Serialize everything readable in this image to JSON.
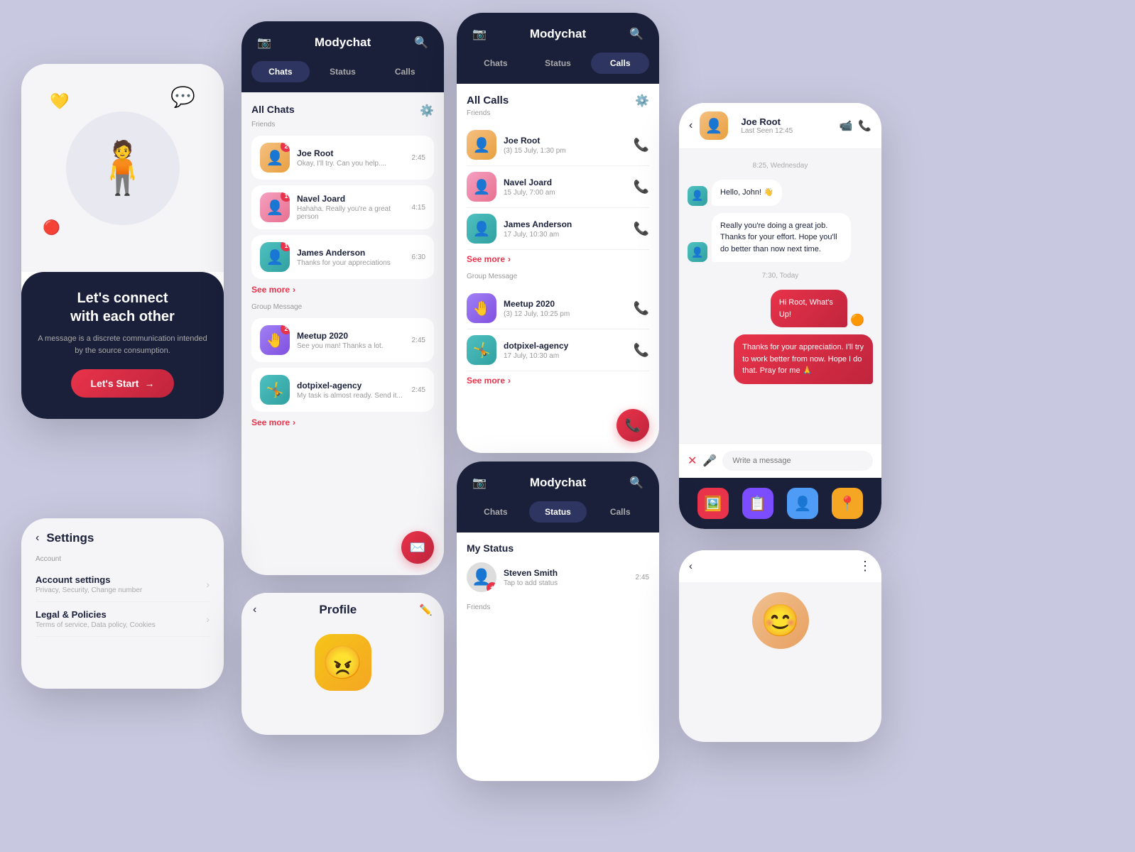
{
  "app": {
    "name": "Modychat",
    "camera_icon": "📷",
    "search_icon": "🔍"
  },
  "welcome": {
    "title": "Let's connect\nwith each other",
    "subtitle": "A message is a discrete communication intended by the source consumption.",
    "btn_label": "Let's Start",
    "btn_arrow": "→"
  },
  "tabs": {
    "chats": "Chats",
    "status": "Status",
    "calls": "Calls"
  },
  "all_chats": {
    "title": "All Chats",
    "friends_label": "Friends",
    "friends": [
      {
        "name": "Joe Root",
        "preview": "Okay, I'll try. Can you help....",
        "time": "2:45",
        "badge": "2",
        "emoji": "👤"
      },
      {
        "name": "Navel Joard",
        "preview": "Hahaha. Really you're a great person",
        "time": "4:15",
        "badge": "1",
        "emoji": "👤"
      },
      {
        "name": "James Anderson",
        "preview": "Thanks for your appreciations",
        "time": "6:30",
        "badge": "1",
        "emoji": "👤"
      }
    ],
    "see_more": "See more",
    "group_label": "Group Message",
    "groups": [
      {
        "name": "Meetup 2020",
        "preview": "See you man! Thanks a lot.",
        "time": "2:45",
        "badge": "2",
        "emoji": "🤚"
      },
      {
        "name": "dotpixel-agency",
        "preview": "My task is almost ready. Send it...",
        "time": "2:45",
        "emoji": "🤸"
      }
    ],
    "see_more2": "See more"
  },
  "all_calls": {
    "title": "All Calls",
    "friends_label": "Friends",
    "friends": [
      {
        "name": "Joe Root",
        "time": "(3) 15 July, 1:30 pm",
        "type": "incoming",
        "emoji": "👤"
      },
      {
        "name": "Navel Joard",
        "time": "15 July, 7:00 am",
        "type": "outgoing",
        "emoji": "👤"
      },
      {
        "name": "James Anderson",
        "time": "17 July, 10:30 am",
        "type": "incoming",
        "emoji": "👤"
      }
    ],
    "see_more": "See more",
    "group_label": "Group Message",
    "groups": [
      {
        "name": "Meetup 2020",
        "time": "(3) 12 July, 10:25 pm",
        "type": "outgoing",
        "emoji": "🤚"
      },
      {
        "name": "dotpixel-agency",
        "time": "17 July, 10:30 am",
        "type": "outgoing",
        "emoji": "🤸"
      }
    ],
    "see_more2": "See more"
  },
  "chat_detail": {
    "contact_name": "Joe Root",
    "last_seen": "Last Seen 12:45",
    "date_label": "8:25, Wednesday",
    "messages": [
      {
        "type": "recv",
        "text": "Hello, John! 👋",
        "time": ""
      },
      {
        "type": "recv",
        "text": "Really you're doing a great job. Thanks for your effort. Hope you'll do better than now next time.",
        "time": ""
      },
      {
        "type": "date",
        "text": "7:30, Today"
      },
      {
        "type": "sent",
        "text": "Hi Root, What's Up!",
        "emoji": "🟠"
      },
      {
        "type": "sent",
        "text": "Thanks for your appreciation. I'll try to work better from now. Hope I do that. Pray for me 🙏"
      }
    ],
    "input_placeholder": "Write a message"
  },
  "settings": {
    "title": "Settings",
    "section_label": "Account",
    "items": [
      {
        "title": "Account settings",
        "sub": "Privacy, Security, Change number"
      },
      {
        "title": "Legal & Policies",
        "sub": "Terms of service, Data policy, Cookies"
      }
    ]
  },
  "profile": {
    "title": "Profile",
    "emoji": "😠"
  },
  "status": {
    "my_status_title": "My Status",
    "my_status": {
      "name": "Steven Smith",
      "sub": "Tap to add status",
      "time": "2:45",
      "emoji": "👤"
    },
    "friends_label": "Friends"
  },
  "bottom_bar_actions": [
    "🖼️",
    "📋",
    "👤",
    "📍"
  ],
  "partial": {
    "emoji": "😊"
  }
}
